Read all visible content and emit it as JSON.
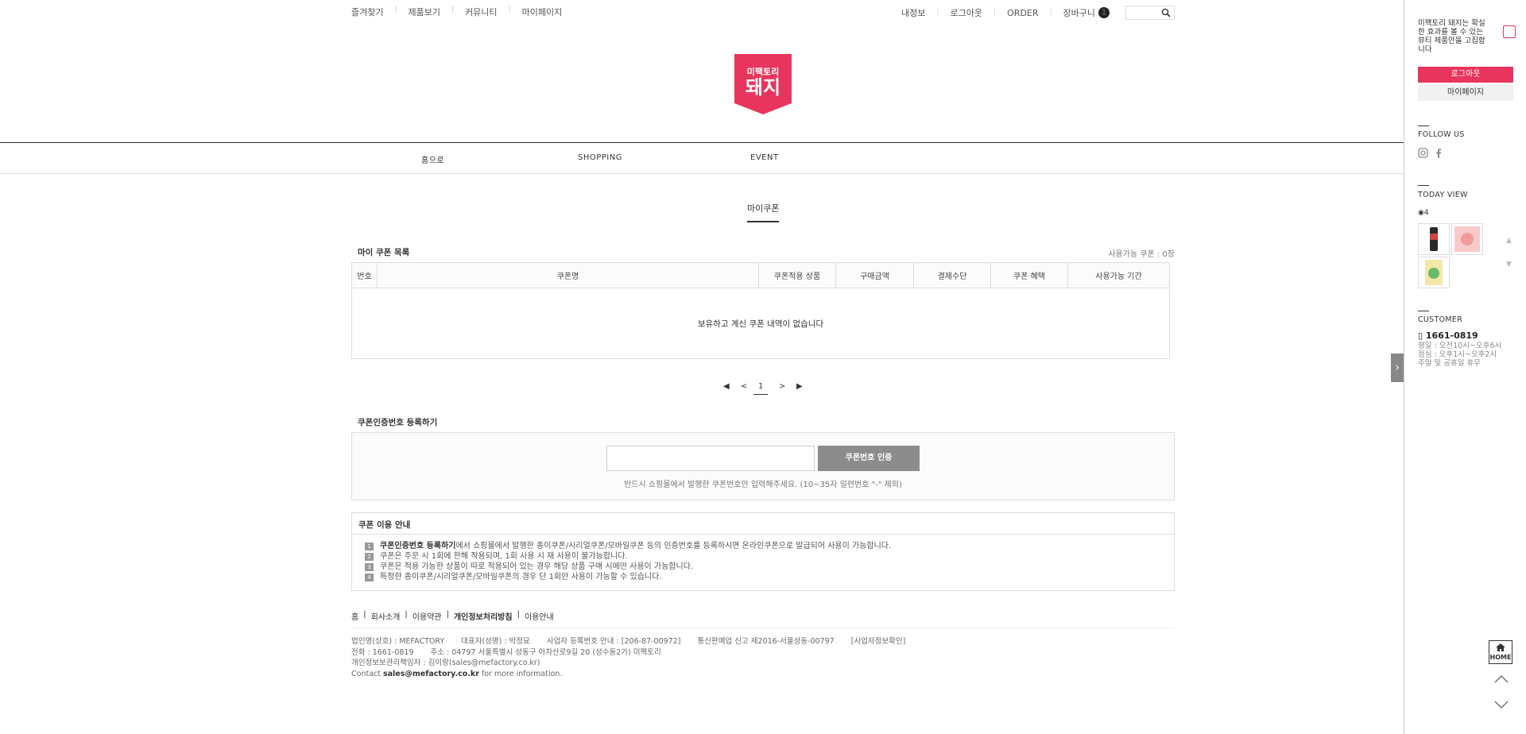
{
  "util": {
    "left": [
      "즐겨찾기",
      "제품보기",
      "커뮤니티",
      "마이페이지"
    ],
    "right": [
      "내정보",
      "로그아웃",
      "ORDER",
      "장바구니"
    ],
    "cart_count": "1"
  },
  "logo": {
    "line1": "미팩토리",
    "line2": "돼지",
    "color": "#e8355d"
  },
  "gnb": [
    "홈으로",
    "SHOPPING",
    "EVENT"
  ],
  "page_title": "마이쿠폰",
  "coupon_list": {
    "heading": "마이 쿠폰 목록",
    "available": "사용가능 쿠폰 : 0장",
    "columns": [
      "번호",
      "쿠폰명",
      "쿠폰적용 상품",
      "구매금액",
      "결제수단",
      "쿠폰 혜택",
      "사용가능 기간"
    ],
    "empty": "보유하고 계신 쿠폰 내역이 없습니다"
  },
  "paging": {
    "current": "1"
  },
  "coupon_auth": {
    "heading": "쿠폰인증번호 등록하기",
    "input_value": "",
    "button": "쿠폰번호 인증",
    "note": "반드시 쇼핑몰에서 발행한 쿠폰번호만 입력해주세요. (10~35자 일련번호 \"-\" 제외)"
  },
  "guide": {
    "title": "쿠폰 이용 안내",
    "items": [
      {
        "num": "1",
        "bold": "쿠폰인증번호 등록하기",
        "text": "에서 쇼핑몰에서 발행한 종이쿠폰/시리얼쿠폰/모바일쿠폰 등의 인증번호를 등록하시면 온라인쿠폰으로 발급되어 사용이 가능합니다."
      },
      {
        "num": "2",
        "bold": "",
        "text": "쿠폰은 주문 시 1회에 한해 적용되며, 1회 사용 시 재 사용이 불가능합니다."
      },
      {
        "num": "3",
        "bold": "",
        "text": "쿠폰은 적용 가능한 상품이 따로 적용되어 있는 경우 해당 상품 구매 시에만 사용이 가능합니다."
      },
      {
        "num": "4",
        "bold": "",
        "text": "특정한 종이쿠폰/시리얼쿠폰/모바일쿠폰의 경우 단 1회만 사용이 가능할 수 있습니다."
      }
    ]
  },
  "footer": {
    "links": [
      "홈",
      "회사소개",
      "이용약관",
      "개인정보처리방침",
      "이용안내"
    ],
    "info_row1": [
      "법인명(상호) : MEFACTORY",
      "대표자(성명) : 박정묘",
      "사업자 등록번호 안내 : [206-87-00972]",
      "통신판매업 신고 제2016-서울성동-00797",
      "[사업자정보확인]"
    ],
    "info_row2": [
      "전화 : 1661-0819",
      "주소 : 04797 서울특별시 성동구 아차산로9길 20 (성수동2가) 미팩토리"
    ],
    "info_row3": "개인정보보관리책임자 : 김이랑(sales@mefactory.co.kr)",
    "contact_prefix": "Contact ",
    "contact_email": "sales@mefactory.co.kr",
    "contact_suffix": " for more information."
  },
  "side": {
    "intro": "미팩토리 돼지는 확실한 효과를 볼 수 있는 뷰티 제품만을 고집합니다",
    "logout": "로그아웃",
    "mypage": "마이페이지",
    "follow": "FOLLOW US",
    "today": "TODAY VIEW",
    "view_count": "4",
    "customer": "CUSTOMER",
    "phone": "1661-0819",
    "hours": [
      "평일 : 오전10시~오후6시",
      "점심 : 오후1시~오후2시",
      "주말 및 공휴일 휴무"
    ],
    "home": "HOME"
  }
}
